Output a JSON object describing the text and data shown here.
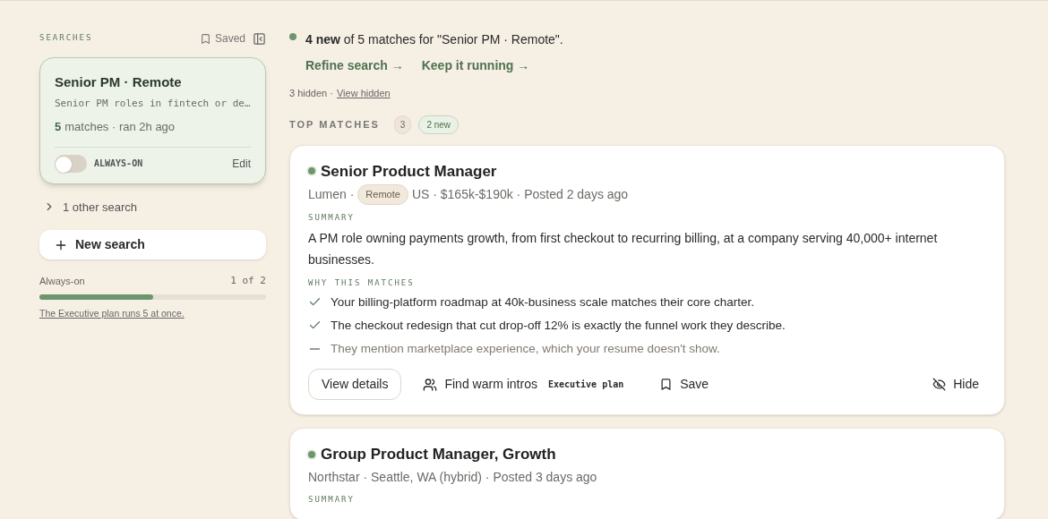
{
  "sidebar": {
    "heading": "SEARCHES",
    "saved_label": "Saved",
    "searches": [
      {
        "title": "Senior PM · Remote",
        "description": "Senior PM roles in fintech or de…",
        "match_count": "5",
        "match_suffix": "matches · ran 2h ago",
        "selected": true,
        "always_on": false,
        "always_on_label": "ALWAYS-ON",
        "edit_label": "Edit"
      }
    ],
    "other_searches": {
      "label": "1 other search",
      "expanded": false
    },
    "new_search": "New search",
    "quota": {
      "label": "Always-on",
      "reading": "1 of 2",
      "level": 0.5,
      "note": "The Executive plan runs 5 at once."
    }
  },
  "main": {
    "banner": {
      "text": "**4 new** of 5 matches for \"Senior PM · Remote\".",
      "links": [
        "Refine search →",
        "Keep it running →"
      ]
    },
    "hidden": {
      "text": "3 hidden ·",
      "link": "View hidden"
    },
    "top_matches": {
      "heading": "TOP MATCHES",
      "count": "3",
      "new_badge": "2 new"
    },
    "jobs": [
      {
        "title": "Senior Product Manager",
        "is_new": true,
        "meta": [
          {
            "kind": "text",
            "text": "Lumen ·"
          },
          {
            "kind": "tag",
            "text": "Remote"
          },
          {
            "kind": "text",
            "text": "US · $165k-$190k · Posted 2 days ago"
          }
        ],
        "summary_label": "SUMMARY",
        "summary": "A PM role owning payments growth, from first checkout to recurring billing, at a company serving 40,000+ internet businesses.",
        "why_label": "WHY THIS MATCHES",
        "reasons": [
          {
            "kind": "match",
            "text": "Your billing-platform roadmap at 40k-business scale matches their core charter."
          },
          {
            "kind": "match",
            "text": "The checkout redesign that cut drop-off 12% is exactly the funnel work they describe."
          },
          {
            "kind": "gap",
            "text": "They mention marketplace experience, which your resume doesn't show."
          }
        ],
        "actions": {
          "details": "View details",
          "intros": "Find warm intros",
          "intros_badge": "Executive plan",
          "save": "Save",
          "hide": "Hide"
        }
      },
      {
        "title": "Group Product Manager, Growth",
        "is_new": true,
        "meta": [
          {
            "kind": "text",
            "text": "Northstar · Seattle, WA (hybrid) · Posted 3 days ago"
          }
        ],
        "summary_label": "SUMMARY"
      }
    ]
  }
}
